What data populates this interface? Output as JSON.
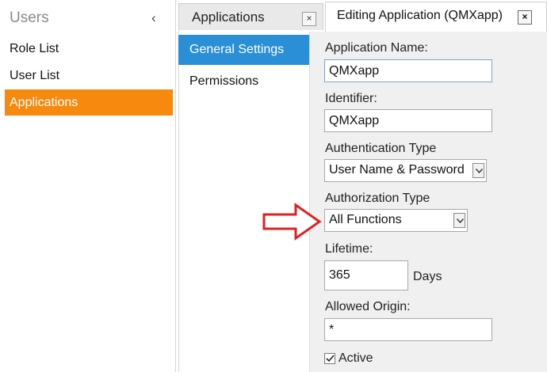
{
  "users_panel": {
    "title": "Users",
    "collapse_glyph": "‹",
    "items": [
      {
        "label": "Role List",
        "active": false
      },
      {
        "label": "User List",
        "active": false
      },
      {
        "label": "Applications",
        "active": true
      }
    ]
  },
  "applications_panel": {
    "tab_label": "Applications",
    "close_glyph": "×",
    "nav": {
      "general": "General Settings",
      "permissions": "Permissions"
    }
  },
  "editor": {
    "tab_label": "Editing Application (QMXapp)",
    "close_glyph": "×",
    "fields": {
      "app_name_label": "Application Name:",
      "app_name_value": "QMXapp",
      "identifier_label": "Identifier:",
      "identifier_value": "QMXapp",
      "auth_type_label": "Authentication Type",
      "auth_type_value": "User Name & Password",
      "authz_type_label": "Authorization Type",
      "authz_type_value": "All Functions",
      "lifetime_label": "Lifetime:",
      "lifetime_value": "365",
      "lifetime_unit": "Days",
      "origin_label": "Allowed Origin:",
      "origin_value": "*",
      "active_label": "Active",
      "active_checked": true
    }
  },
  "colors": {
    "accent_orange": "#f7890f",
    "accent_blue": "#2a8fd6",
    "arrow_red": "#e02020"
  },
  "icons": {
    "arrow": "red-outline-arrow-icon",
    "dropdown": "chevron-down-icon",
    "check": "checkmark-icon"
  }
}
